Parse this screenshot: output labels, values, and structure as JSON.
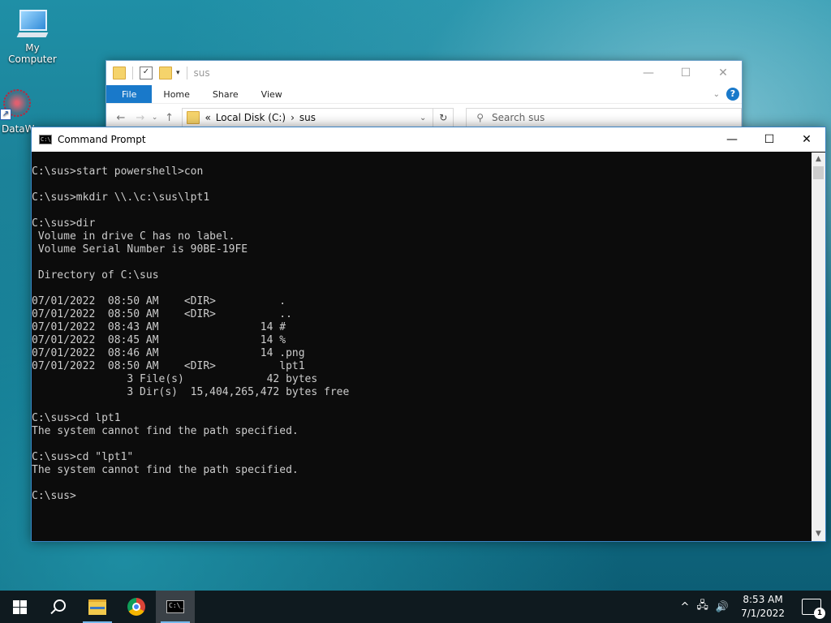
{
  "desktop": {
    "icons": [
      {
        "label": "My Computer"
      },
      {
        "label": "DataW"
      }
    ]
  },
  "explorer": {
    "title": "sus",
    "controls": {
      "minimize": "—",
      "maximize": "☐",
      "close": "✕"
    },
    "ribbon_tabs": [
      "File",
      "Home",
      "Share",
      "View"
    ],
    "address": {
      "parts": [
        "«",
        "Local Disk (C:)",
        "›",
        "sus"
      ]
    },
    "search_placeholder": "Search sus",
    "help_glyph": "?"
  },
  "cmd": {
    "title": "Command Prompt",
    "controls": {
      "minimize": "—",
      "maximize": "☐",
      "close": "✕"
    },
    "lines": [
      "",
      "C:\\sus>start powershell>con",
      "",
      "C:\\sus>mkdir \\\\.\\c:\\sus\\lpt1",
      "",
      "C:\\sus>dir",
      " Volume in drive C has no label.",
      " Volume Serial Number is 90BE-19FE",
      "",
      " Directory of C:\\sus",
      "",
      "07/01/2022  08:50 AM    <DIR>          .",
      "07/01/2022  08:50 AM    <DIR>          ..",
      "07/01/2022  08:43 AM                14 #",
      "07/01/2022  08:45 AM                14 %",
      "07/01/2022  08:46 AM                14 .png",
      "07/01/2022  08:50 AM    <DIR>          lpt1",
      "               3 File(s)             42 bytes",
      "               3 Dir(s)  15,404,265,472 bytes free",
      "",
      "C:\\sus>cd lpt1",
      "The system cannot find the path specified.",
      "",
      "C:\\sus>cd \"lpt1\"",
      "The system cannot find the path specified.",
      "",
      "C:\\sus>"
    ]
  },
  "taskbar": {
    "clock_time": "8:53 AM",
    "clock_date": "7/1/2022",
    "notification_count": "1",
    "tray_glyphs": {
      "chevron": "^",
      "volume": "🔊"
    }
  }
}
